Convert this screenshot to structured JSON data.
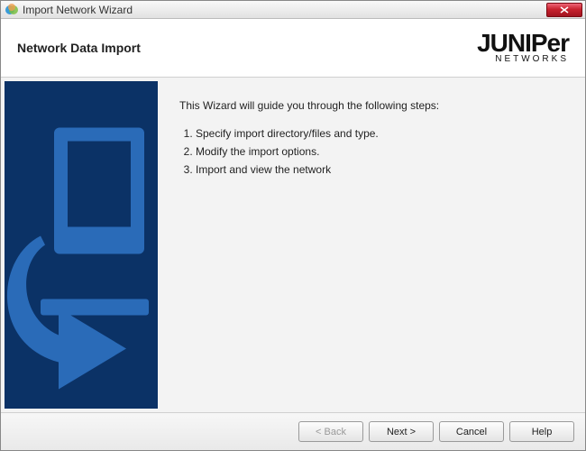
{
  "window": {
    "title": "Import Network Wizard"
  },
  "header": {
    "heading": "Network Data Import",
    "logo_main": "JUNIPer",
    "logo_sub": "NETWORKS"
  },
  "content": {
    "intro": "This Wizard will guide you through the following steps:",
    "steps": [
      "Specify import directory/files and type.",
      "Modify the import options.",
      "Import and view the network"
    ]
  },
  "footer": {
    "back_label": "< Back",
    "next_label": "Next >",
    "cancel_label": "Cancel",
    "help_label": "Help"
  }
}
